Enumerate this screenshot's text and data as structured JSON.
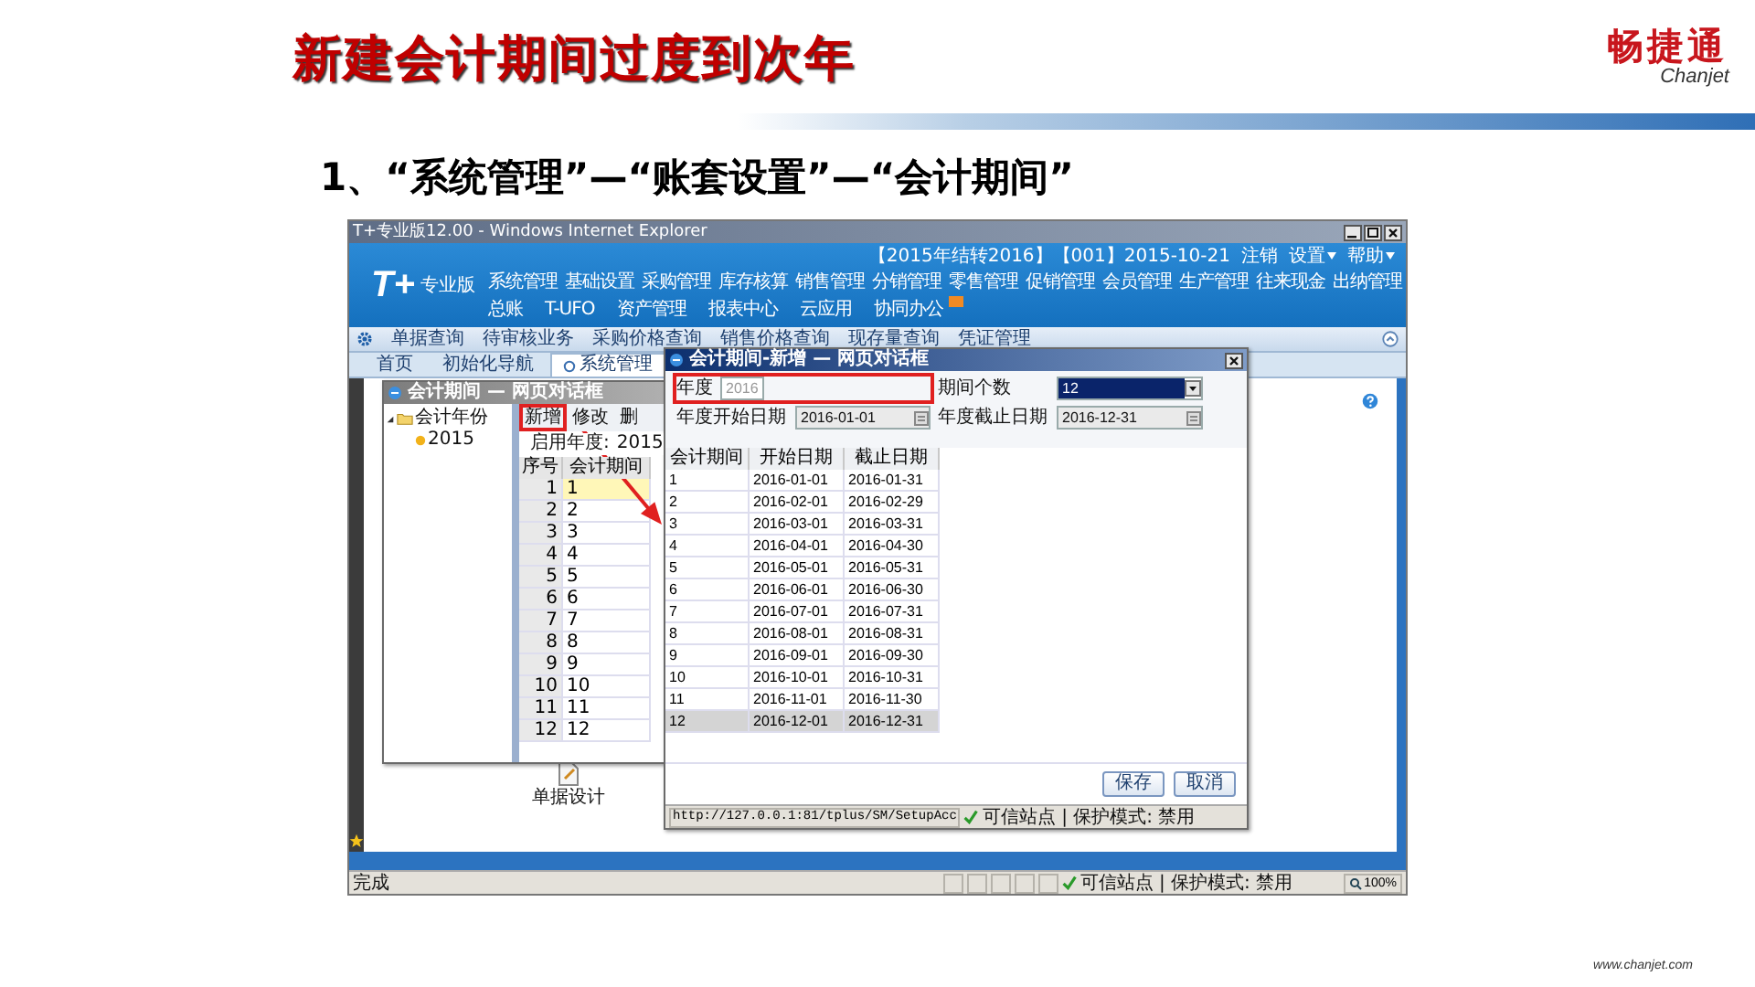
{
  "slide": {
    "title": "新建会计期间过度到次年",
    "logo": "畅捷通",
    "logo_latin": "Chanjet",
    "subtitle": "1、“系统管理”—“账套设置”—“会计期间”",
    "footer": "www.chanjet.com"
  },
  "browser": {
    "title": "T+专业版12.00 - Windows Internet Explorer",
    "status": "完成",
    "zone": "可信站点 | 保护模式: 禁用",
    "zoom": "100%"
  },
  "app": {
    "logo": "T+",
    "edition": "专业版",
    "account": "【2015年结转2016】【001】2015-10-21",
    "header_links": [
      {
        "label": "注销",
        "dropdown": false
      },
      {
        "label": "设置",
        "dropdown": true
      },
      {
        "label": "帮助",
        "dropdown": true
      }
    ],
    "menu": [
      [
        {
          "label": "系统管理",
          "badge": false
        },
        {
          "label": "基础设置",
          "badge": false
        },
        {
          "label": "采购管理",
          "badge": false
        },
        {
          "label": "库存核算",
          "badge": false
        },
        {
          "label": "销售管理",
          "badge": false
        },
        {
          "label": "分销管理",
          "badge": false
        },
        {
          "label": "零售管理",
          "badge": false
        },
        {
          "label": "促销管理",
          "badge": false
        },
        {
          "label": "会员管理",
          "badge": false
        },
        {
          "label": "生产管理",
          "badge": false
        },
        {
          "label": "往来现金",
          "badge": false
        },
        {
          "label": "出纳管理",
          "badge": false
        }
      ],
      [
        {
          "label": "总账",
          "badge": false
        },
        {
          "label": "T-UFO",
          "badge": false
        },
        {
          "label": "资产管理",
          "badge": false
        },
        {
          "label": "报表中心",
          "badge": false
        },
        {
          "label": "云应用",
          "badge": false
        },
        {
          "label": "协同办公",
          "badge": true
        }
      ]
    ],
    "quick_links": [
      "单据查询",
      "待审核业务",
      "采购价格查询",
      "销售价格查询",
      "现存量查询",
      "凭证管理"
    ],
    "tabs": [
      {
        "label": "首页",
        "selected": false
      },
      {
        "label": "初始化导航",
        "selected": false
      },
      {
        "label": "系统管理",
        "selected": true
      }
    ],
    "desktop_items": [
      {
        "label": "单据设计"
      }
    ]
  },
  "periods_dialog": {
    "title": "会计期间 — 网页对话框",
    "tree": [
      {
        "label": "会计年份",
        "expanded": true,
        "children": [
          {
            "label": "2015"
          }
        ]
      }
    ],
    "toolbar": [
      {
        "label": "新增",
        "highlighted": true
      },
      {
        "label": "修改",
        "highlighted": false
      },
      {
        "label": "删",
        "highlighted": false
      }
    ],
    "start_year_label": "启用年度:",
    "start_year": "2015",
    "columns": [
      "序号",
      "会计期间"
    ],
    "rows": [
      {
        "cells": [
          "1",
          "1"
        ],
        "selected": true
      },
      {
        "cells": [
          "2",
          "2"
        ],
        "selected": false
      },
      {
        "cells": [
          "3",
          "3"
        ],
        "selected": false
      },
      {
        "cells": [
          "4",
          "4"
        ],
        "selected": false
      },
      {
        "cells": [
          "5",
          "5"
        ],
        "selected": false
      },
      {
        "cells": [
          "6",
          "6"
        ],
        "selected": false
      },
      {
        "cells": [
          "7",
          "7"
        ],
        "selected": false
      },
      {
        "cells": [
          "8",
          "8"
        ],
        "selected": false
      },
      {
        "cells": [
          "9",
          "9"
        ],
        "selected": false
      },
      {
        "cells": [
          "10",
          "10"
        ],
        "selected": false
      },
      {
        "cells": [
          "11",
          "11"
        ],
        "selected": false
      },
      {
        "cells": [
          "12",
          "12"
        ],
        "selected": false
      }
    ]
  },
  "new_period_dialog": {
    "title": "会计期间-新增 — 网页对话框",
    "fields": [
      {
        "label": "年度",
        "value": "2016",
        "kind": "text",
        "disabled": true,
        "highlighted": true
      },
      {
        "label": "期间个数",
        "value": "12",
        "kind": "select",
        "disabled": false,
        "highlighted": false
      },
      {
        "label": "年度开始日期",
        "value": "2016-01-01",
        "kind": "date",
        "disabled": false,
        "highlighted": false
      },
      {
        "label": "年度截止日期",
        "value": "2016-12-31",
        "kind": "date",
        "disabled": false,
        "highlighted": false
      }
    ],
    "columns": [
      "会计期间",
      "开始日期",
      "截止日期"
    ],
    "rows": [
      {
        "cells": [
          "1",
          "2016-01-01",
          "2016-01-31"
        ],
        "selected": false
      },
      {
        "cells": [
          "2",
          "2016-02-01",
          "2016-02-29"
        ],
        "selected": false
      },
      {
        "cells": [
          "3",
          "2016-03-01",
          "2016-03-31"
        ],
        "selected": false
      },
      {
        "cells": [
          "4",
          "2016-04-01",
          "2016-04-30"
        ],
        "selected": false
      },
      {
        "cells": [
          "5",
          "2016-05-01",
          "2016-05-31"
        ],
        "selected": false
      },
      {
        "cells": [
          "6",
          "2016-06-01",
          "2016-06-30"
        ],
        "selected": false
      },
      {
        "cells": [
          "7",
          "2016-07-01",
          "2016-07-31"
        ],
        "selected": false
      },
      {
        "cells": [
          "8",
          "2016-08-01",
          "2016-08-31"
        ],
        "selected": false
      },
      {
        "cells": [
          "9",
          "2016-09-01",
          "2016-09-30"
        ],
        "selected": false
      },
      {
        "cells": [
          "10",
          "2016-10-01",
          "2016-10-31"
        ],
        "selected": false
      },
      {
        "cells": [
          "11",
          "2016-11-01",
          "2016-11-30"
        ],
        "selected": false
      },
      {
        "cells": [
          "12",
          "2016-12-01",
          "2016-12-31"
        ],
        "selected": true
      }
    ],
    "buttons": [
      "保存",
      "取消"
    ],
    "status_url": "http://127.0.0.1:81/tplus/SM/SetupAcc",
    "zone": "可信站点 | 保护模式: 禁用"
  }
}
